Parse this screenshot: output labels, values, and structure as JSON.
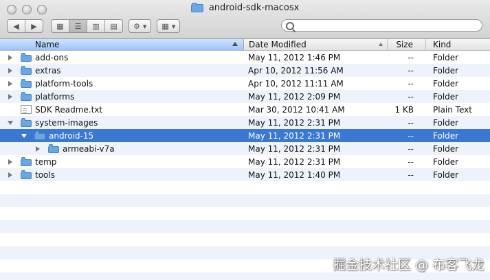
{
  "window": {
    "title": "android-sdk-macosx",
    "title_icon": "folder-icon"
  },
  "toolbar": {
    "nav": [
      {
        "icon": "back-icon",
        "label": "◀"
      },
      {
        "icon": "forward-icon",
        "label": "▶"
      }
    ],
    "views": [
      {
        "icon": "view-icons-icon",
        "label": "▦",
        "selected": false
      },
      {
        "icon": "view-list-icon",
        "label": "☰",
        "selected": true
      },
      {
        "icon": "view-columns-icon",
        "label": "▥",
        "selected": false
      },
      {
        "icon": "view-coverflow-icon",
        "label": "▤",
        "selected": false
      }
    ],
    "action_menu": {
      "icon": "gear-icon",
      "glyph": "⚙",
      "caret": "▾"
    },
    "arrange_menu": {
      "icon": "arrange-icon",
      "glyph": "▦",
      "caret": "▾"
    },
    "search": {
      "placeholder": "",
      "value": ""
    }
  },
  "columns": {
    "name": "Name",
    "date": "Date Modified",
    "size": "Size",
    "kind": "Kind"
  },
  "rows": [
    {
      "name": "add-ons",
      "date": "May 11, 2012 1:46 PM",
      "size": "--",
      "kind": "Folder",
      "icon": "folder-icon",
      "indent": 0,
      "disclosure": "collapsed"
    },
    {
      "name": "extras",
      "date": "Apr 10, 2012 11:56 AM",
      "size": "--",
      "kind": "Folder",
      "icon": "folder-icon",
      "indent": 0,
      "disclosure": "collapsed"
    },
    {
      "name": "platform-tools",
      "date": "Apr 10, 2012 11:11 AM",
      "size": "--",
      "kind": "Folder",
      "icon": "folder-icon",
      "indent": 0,
      "disclosure": "collapsed"
    },
    {
      "name": "platforms",
      "date": "May 11, 2012 2:09 PM",
      "size": "--",
      "kind": "Folder",
      "icon": "folder-icon",
      "indent": 0,
      "disclosure": "collapsed"
    },
    {
      "name": "SDK Readme.txt",
      "date": "Mar 30, 2012 10:41 AM",
      "size": "1 KB",
      "kind": "Plain Text",
      "icon": "text-file-icon",
      "indent": 0,
      "disclosure": "none"
    },
    {
      "name": "system-images",
      "date": "May 11, 2012 2:31 PM",
      "size": "--",
      "kind": "Folder",
      "icon": "folder-icon",
      "indent": 0,
      "disclosure": "expanded"
    },
    {
      "name": "android-15",
      "date": "May 11, 2012 2:31 PM",
      "size": "--",
      "kind": "Folder",
      "icon": "folder-icon",
      "indent": 1,
      "disclosure": "expanded",
      "selected": true
    },
    {
      "name": "armeabi-v7a",
      "date": "May 11, 2012 2:31 PM",
      "size": "--",
      "kind": "Folder",
      "icon": "folder-icon",
      "indent": 2,
      "disclosure": "collapsed"
    },
    {
      "name": "temp",
      "date": "May 11, 2012 2:31 PM",
      "size": "--",
      "kind": "Folder",
      "icon": "folder-icon",
      "indent": 0,
      "disclosure": "collapsed"
    },
    {
      "name": "tools",
      "date": "May 11, 2012 1:40 PM",
      "size": "--",
      "kind": "Folder",
      "icon": "folder-icon",
      "indent": 0,
      "disclosure": "collapsed"
    }
  ],
  "watermark": "掘金技术社区 @ 布客飞龙",
  "colors": {
    "selection": "#3a78d4",
    "alt_row": "#eef3fb",
    "folder": "#6aa7e5"
  }
}
